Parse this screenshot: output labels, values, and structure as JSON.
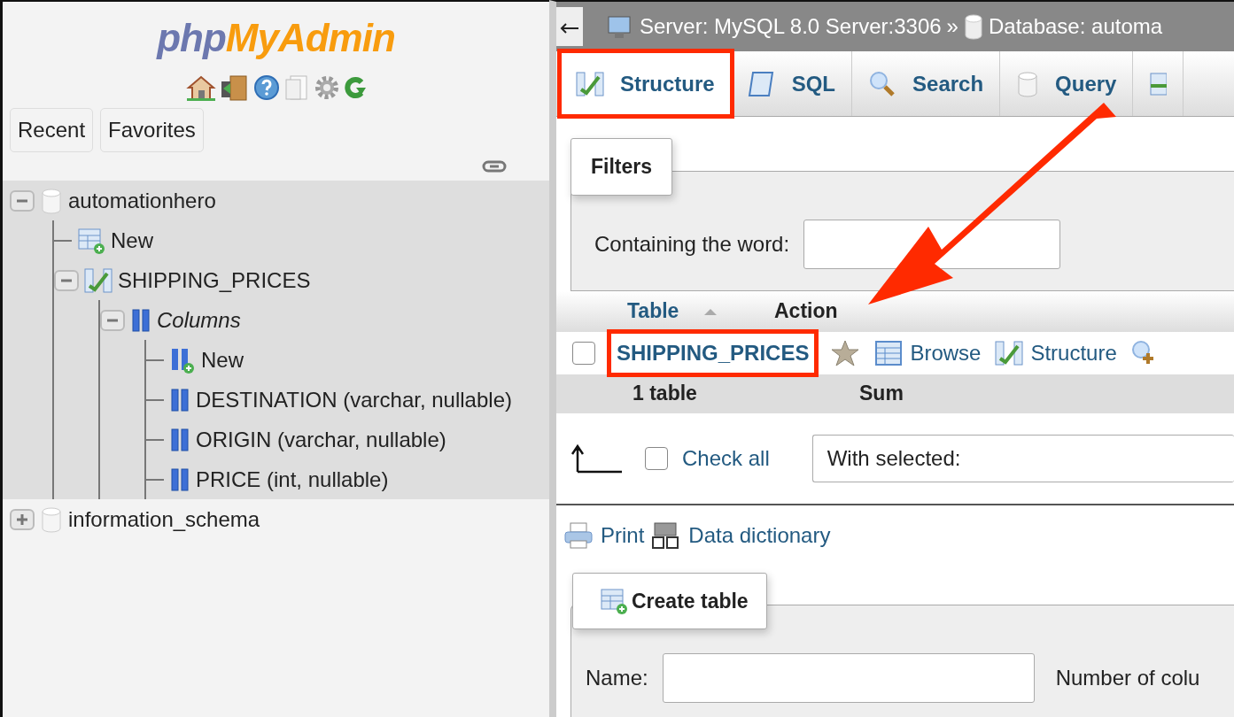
{
  "sidebar": {
    "logo": {
      "first": "php",
      "second": "MyAdmin"
    },
    "buttons": [
      "Recent",
      "Favorites"
    ],
    "tree": [
      {
        "label": "automationhero",
        "kind": "database",
        "expanded": true,
        "children": [
          {
            "label": "New",
            "kind": "new-table"
          },
          {
            "label": "SHIPPING_PRICES",
            "kind": "table",
            "expanded": true,
            "children": [
              {
                "label": "Columns",
                "kind": "columns",
                "expanded": true,
                "children": [
                  {
                    "label": "New",
                    "kind": "new-column"
                  },
                  {
                    "label": "DESTINATION (varchar, nullable)",
                    "kind": "column"
                  },
                  {
                    "label": "ORIGIN (varchar, nullable)",
                    "kind": "column"
                  },
                  {
                    "label": "PRICE (int, nullable)",
                    "kind": "column"
                  }
                ]
              }
            ]
          }
        ]
      },
      {
        "label": "information_schema",
        "kind": "database",
        "expanded": false
      }
    ]
  },
  "breadcrumb": {
    "server": "Server: MySQL 8.0 Server:3306",
    "separator": "»",
    "database": "Database: automa"
  },
  "tabs": [
    {
      "label": "Structure",
      "kind": "structure",
      "selected": true,
      "highlighted": true
    },
    {
      "label": "SQL",
      "kind": "sql",
      "selected": false,
      "highlighted": false
    },
    {
      "label": "Search",
      "kind": "search",
      "selected": false,
      "highlighted": false
    },
    {
      "label": "Query",
      "kind": "query",
      "selected": false,
      "highlighted": false
    },
    {
      "kind": "export",
      "selected": false,
      "highlighted": false
    }
  ],
  "filters": {
    "legend": "Filters",
    "label": "Containing the word:"
  },
  "table": {
    "columns": [
      "Table",
      "Action"
    ],
    "rows": [
      {
        "name": "SHIPPING_PRICES",
        "checked": false,
        "highlighted": true,
        "actions": [
          "Browse",
          "Structure"
        ]
      }
    ],
    "footer": [
      "1 table",
      "Sum"
    ]
  },
  "bulk": {
    "check_all": "Check all",
    "checked": false,
    "with_selected": "With selected:"
  },
  "links": [
    "Print",
    "Data dictionary"
  ],
  "create_table": {
    "legend": "Create table",
    "name_label": "Name:",
    "columns_label": "Number of colu"
  }
}
